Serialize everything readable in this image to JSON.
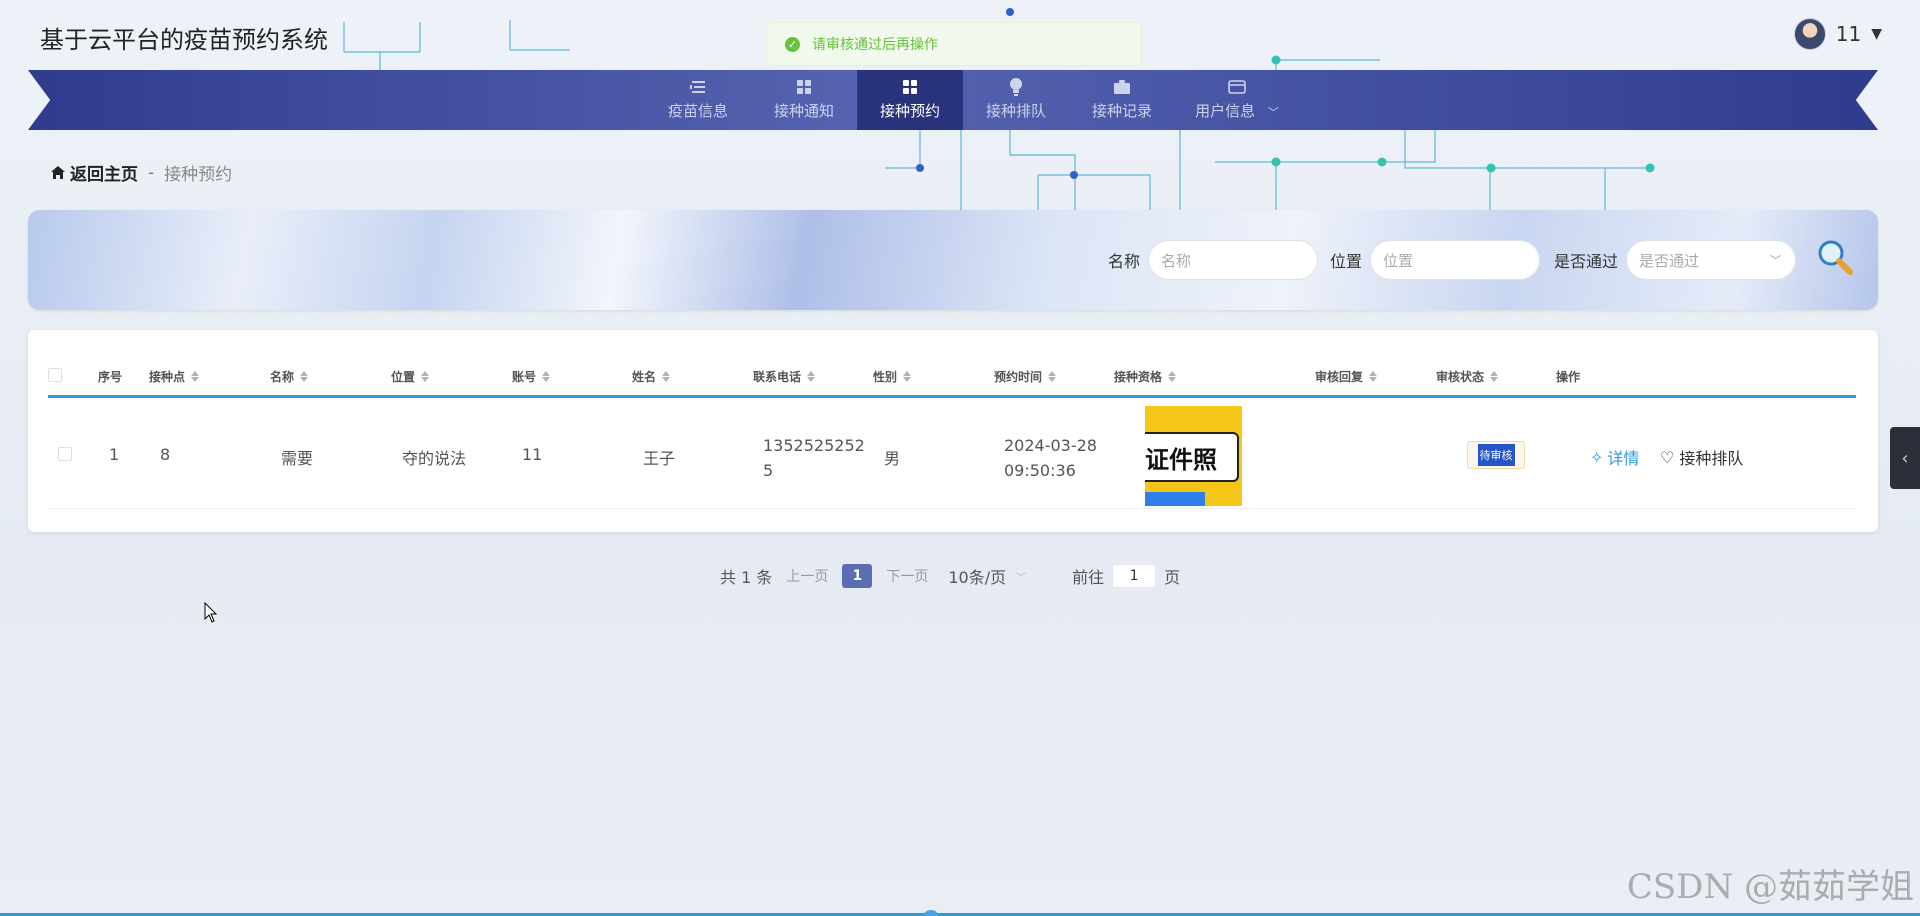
{
  "app": {
    "title": "基于云平台的疫苗预约系统"
  },
  "user": {
    "name": "11"
  },
  "toast": {
    "message": "请审核通过后再操作",
    "color": "#67c23a"
  },
  "nav": {
    "items": [
      {
        "label": "疫苗信息",
        "icon": "list-icon"
      },
      {
        "label": "接种通知",
        "icon": "grid-icon"
      },
      {
        "label": "接种预约",
        "icon": "grid-icon",
        "active": true
      },
      {
        "label": "接种排队",
        "icon": "bulb-icon"
      },
      {
        "label": "接种记录",
        "icon": "briefcase-icon"
      },
      {
        "label": "用户信息",
        "icon": "wallet-icon"
      }
    ]
  },
  "breadcrumb": {
    "home": "返回主页",
    "separator": "-",
    "current": "接种预约"
  },
  "search": {
    "name_label": "名称",
    "name_placeholder": "名称",
    "location_label": "位置",
    "location_placeholder": "位置",
    "passed_label": "是否通过",
    "passed_placeholder": "是否通过"
  },
  "table": {
    "headers": [
      "序号",
      "接种点",
      "名称",
      "位置",
      "账号",
      "姓名",
      "联系电话",
      "性别",
      "预约时间",
      "接种资格",
      "审核回复",
      "审核状态",
      "操作"
    ],
    "rows": [
      {
        "index": "1",
        "site": "8",
        "name": "需要",
        "location": "夺的说法",
        "account": "11",
        "person": "王子",
        "phone_line1": "1352525252",
        "phone_line2": "5",
        "gender": "男",
        "time_line1": "2024-03-28",
        "time_line2": "09:50:36",
        "qualification_image_text": "证件照",
        "reply": "",
        "status": "待审核",
        "op_detail": "详情",
        "op_queue": "接种排队"
      }
    ]
  },
  "pager": {
    "total": "共 1 条",
    "prev": "上一页",
    "current": "1",
    "next": "下一页",
    "size": "10条/页",
    "goto_label": "前往",
    "goto_value": "1",
    "page_unit": "页"
  },
  "watermark": "CSDN @茹茹学姐",
  "colors": {
    "nav_active": "#28337c",
    "accent": "#2f9bd6",
    "status_badge": "#2456c9",
    "cert_bg": "#f5c518"
  }
}
